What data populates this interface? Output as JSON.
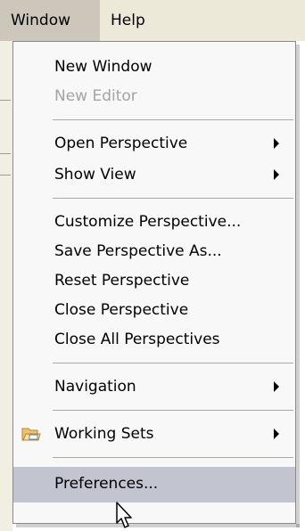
{
  "menubar": {
    "window_label": "Window",
    "help_label": "Help"
  },
  "menu": {
    "items": [
      {
        "label": "New Window",
        "enabled": true
      },
      {
        "label": "New Editor",
        "enabled": false
      },
      {
        "label": "Open Perspective",
        "submenu": true
      },
      {
        "label": "Show View",
        "submenu": true
      },
      {
        "label": "Customize Perspective..."
      },
      {
        "label": "Save Perspective As..."
      },
      {
        "label": "Reset Perspective"
      },
      {
        "label": "Close Perspective"
      },
      {
        "label": "Close All Perspectives"
      },
      {
        "label": "Navigation",
        "submenu": true
      },
      {
        "label": "Working Sets",
        "submenu": true,
        "icon": "folder-icon"
      },
      {
        "label": "Preferences...",
        "selected": true
      }
    ]
  },
  "colors": {
    "menubar_bg": "#ece9d8",
    "active_menu_bg": "#ccc7ba",
    "selected_item_bg": "#c2c4cf",
    "disabled_text": "#a3a3a3"
  },
  "cursor": "arrow-pointer-icon"
}
